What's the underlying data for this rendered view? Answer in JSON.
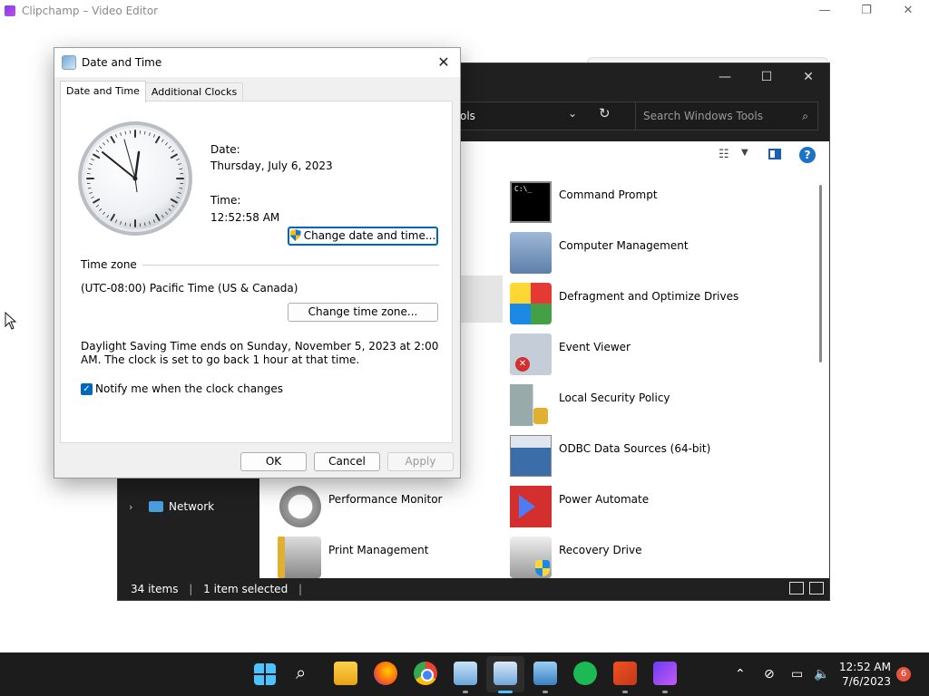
{
  "clipchamp": {
    "title": "Clipchamp – Video Editor",
    "controls": [
      "—",
      "❐",
      "✕"
    ]
  },
  "windows_tools": {
    "address": "ols",
    "search_placeholder": "Search Windows Tools",
    "controls": [
      "—",
      "☐",
      "✕"
    ],
    "nav": {
      "network_label": "Network"
    },
    "tools": [
      {
        "label": "Command Prompt",
        "icon": "command-prompt-icon"
      },
      {
        "label": "Computer Management",
        "icon": "computer-management-icon"
      },
      {
        "label": "Defragment and Optimize Drives",
        "icon": "defragment-icon"
      },
      {
        "label": "Event Viewer",
        "icon": "event-viewer-icon"
      },
      {
        "label": "Local Security Policy",
        "icon": "local-security-policy-icon"
      },
      {
        "label": "ODBC Data Sources (64-bit)",
        "icon": "odbc-icon"
      },
      {
        "label": "Performance Monitor",
        "icon": "performance-monitor-icon"
      },
      {
        "label": "Power Automate",
        "icon": "power-automate-icon"
      },
      {
        "label": "Print Management",
        "icon": "print-management-icon"
      },
      {
        "label": "Recovery Drive",
        "icon": "recovery-drive-icon"
      }
    ],
    "status": {
      "items": "34 items",
      "selected": "1 item selected"
    }
  },
  "dialog": {
    "title": "Date and Time",
    "tabs": [
      "Date and Time",
      "Additional Clocks"
    ],
    "date_label": "Date:",
    "date_value": "Thursday, July 6, 2023",
    "time_label": "Time:",
    "time_value": "12:52:58 AM",
    "change_datetime": "Change date and time...",
    "timezone_label": "Time zone",
    "timezone_value": "(UTC-08:00) Pacific Time (US & Canada)",
    "change_timezone": "Change time zone...",
    "dst_text": "Daylight Saving Time ends on Sunday, November 5, 2023 at 2:00 AM. The clock is set to go back 1 hour at that time.",
    "notify_label": "Notify me when the clock changes",
    "notify_checked": true,
    "ok": "OK",
    "cancel": "Cancel",
    "apply": "Apply"
  },
  "taskbar": {
    "time": "12:52 AM",
    "date": "7/6/2023",
    "notification_count": "6",
    "tray_icons": [
      "chevron-up-icon",
      "network-off-icon",
      "display-icon",
      "volume-icon"
    ]
  }
}
